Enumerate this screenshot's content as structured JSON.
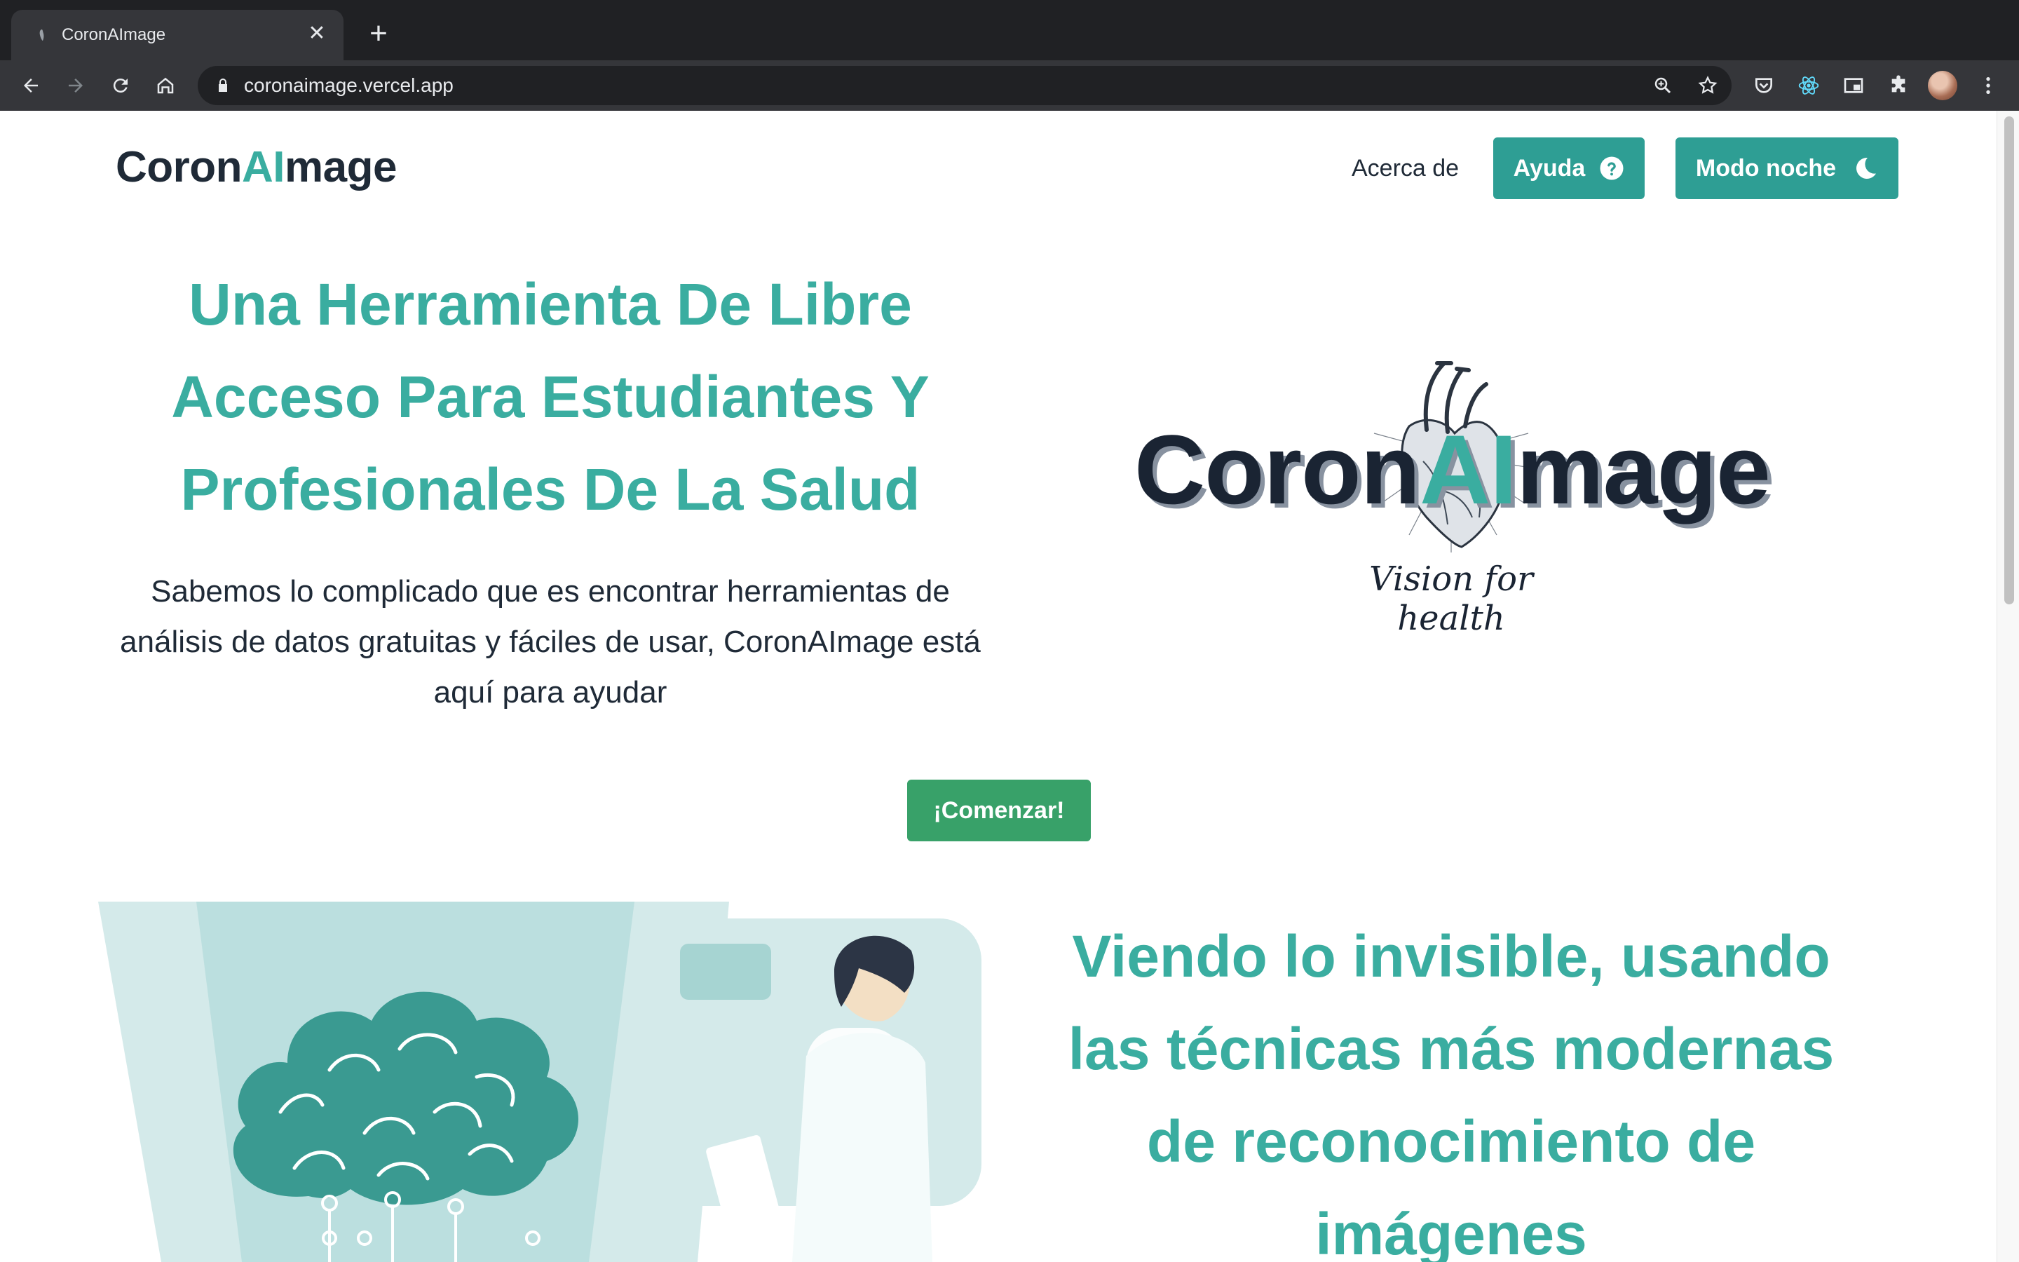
{
  "browser": {
    "tab_title": "CoronAImage",
    "url": "coronaimage.vercel.app"
  },
  "header": {
    "brand_prefix": "Coron",
    "brand_ai": "AI",
    "brand_suffix": "mage",
    "nav_about": "Acerca de",
    "help_button": "Ayuda",
    "night_button": "Modo noche"
  },
  "hero": {
    "title": "Una Herramienta De Libre Acceso Para Estudiantes Y Profesionales De La Salud",
    "text": "Sabemos lo complicado que es encontrar herramientas de análisis de datos gratuitas y fáciles de usar, CoronAImage está aquí para ayudar",
    "cta": "¡Comenzar!"
  },
  "logo": {
    "prefix": "Coron",
    "ai": "AI",
    "suffix": "mage",
    "tagline": "Vision for health"
  },
  "section2": {
    "title": "Viendo lo invisible, usando las técnicas más modernas de reconocimiento de imágenes"
  },
  "colors": {
    "accent": "#3aada0",
    "button": "#2e9e94",
    "cta": "#38a169",
    "dark": "#1f2a37"
  }
}
